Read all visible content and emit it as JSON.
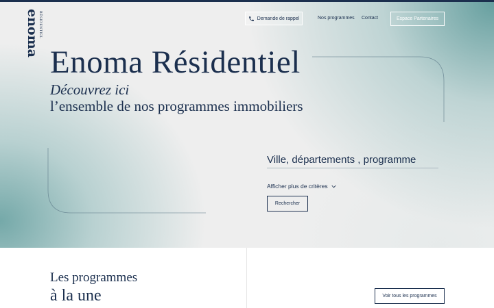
{
  "brand": {
    "logo_main": "enoma",
    "logo_sub": "RÉSIDENTIEL"
  },
  "nav": {
    "callback_label": "Demande de rappel",
    "programmes_label": "Nos programmes",
    "contact_label": "Contact",
    "partners_label": "Espace Partenaires"
  },
  "hero": {
    "title": "Enoma Résidentiel",
    "subtitle_italic": "Découvrez ici",
    "subtitle": "l’ensemble de nos programmes immobiliers"
  },
  "search": {
    "placeholder": "Ville, départements , programme",
    "more_criteria_label": "Afficher plus de critères",
    "search_button_label": "Rechercher"
  },
  "featured": {
    "heading_line1": "Les programmes",
    "heading_line2": "à la une",
    "see_all_label": "Voir tous les programmes"
  },
  "colors": {
    "navy": "#1b2f4e",
    "teal": "#5f9b9b",
    "background": "#eeeeee"
  },
  "icons": {
    "callback": "phone-icon",
    "more_criteria": "chevron-down-icon"
  }
}
